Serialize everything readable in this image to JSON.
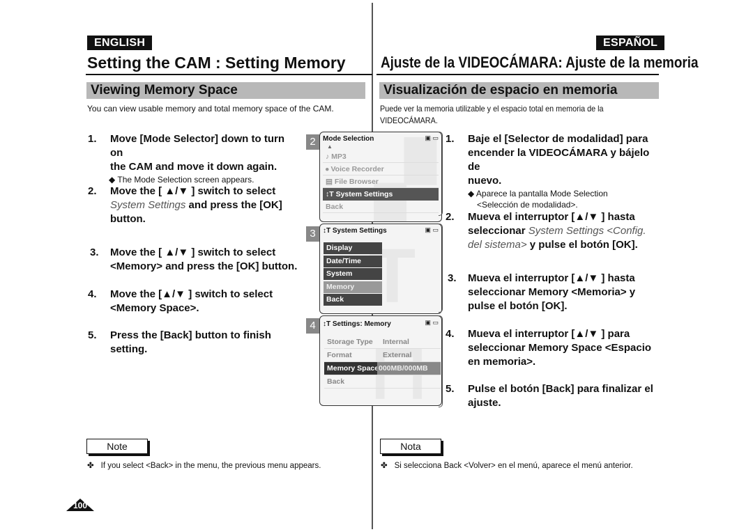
{
  "english": {
    "lang_label": "ENGLISH",
    "title": "Setting the CAM : Setting Memory",
    "section": "Viewing Memory Space",
    "intro": "You can view usable memory and total memory space of the CAM.",
    "steps": [
      {
        "num": "1.",
        "line1": "Move [Mode Selector] down to turn on",
        "line2": "the CAM and move it down again.",
        "sub": "The Mode Selection screen appears."
      },
      {
        "num": "2.",
        "line1": "Move the [ ▲/▼ ] switch to select",
        "line2_italic": "System Settings",
        "line2_rest": " and press the [OK]",
        "line3": "button."
      },
      {
        "num": "3.",
        "line1": "Move the [ ▲/▼ ] switch to select",
        "line2": "<Memory> and press the [OK] button."
      },
      {
        "num": "4.",
        "line1": "Move the [▲/▼ ] switch to select",
        "line2": "<Memory Space>."
      },
      {
        "num": "5.",
        "line1": "Press the [Back] button to finish",
        "line2": "setting."
      }
    ],
    "note_label": "Note",
    "note_text": "If you select <Back> in the menu, the previous menu appears."
  },
  "spanish": {
    "lang_label": "ESPAÑOL",
    "title": "Ajuste de la VIDEOCÁMARA: Ajuste de la memoria",
    "section": "Visualización de espacio en memoria",
    "intro_line1": "Puede ver la memoria utilizable y el espacio total en memoria de la",
    "intro_line2": "VIDEOCÁMARA.",
    "steps": [
      {
        "num": "1.",
        "line1": "Baje el [Selector de modalidad] para",
        "line2": "encender la VIDEOCÁMARA y bájelo de",
        "line3": "nuevo.",
        "sub1": "Aparece la pantalla Mode Selection",
        "sub2": "<Selección de modalidad>."
      },
      {
        "num": "2.",
        "line1": "Mueva el interruptor [▲/▼ ] hasta",
        "line2_a": "seleccionar ",
        "line2_italic": "System Settings <Config.",
        "line3_italic": "del sistema>",
        "line3_rest": " y pulse el botón [OK]."
      },
      {
        "num": "3.",
        "line1": "Mueva el interruptor [▲/▼ ] hasta",
        "line2": "seleccionar Memory <Memoria> y",
        "line3": "pulse el botón [OK]."
      },
      {
        "num": "4.",
        "line1": "Mueva el interruptor [▲/▼ ] para",
        "line2": "seleccionar Memory Space <Espacio",
        "line3": "en memoria>."
      },
      {
        "num": "5.",
        "line1": "Pulse el botón [Back] para finalizar el",
        "line2": "ajuste."
      }
    ],
    "note_label": "Nota",
    "note_text": "Si selecciona Back <Volver> en el menú, aparece el menú anterior."
  },
  "screens": [
    {
      "number": "2",
      "title": "Mode Selection",
      "items": [
        {
          "icon": "music-note-icon",
          "glyph": "♪",
          "label": "MP3"
        },
        {
          "icon": "microphone-icon",
          "glyph": "🎙",
          "label": "Voice Recorder"
        },
        {
          "icon": "file-icon",
          "glyph": "▤",
          "label": "File Browser"
        },
        {
          "icon": "settings-tools-icon",
          "glyph": "⫶T",
          "label": "System Settings",
          "selected": true
        },
        {
          "label": "Back"
        }
      ]
    },
    {
      "number": "3",
      "title": "System Settings",
      "items": [
        {
          "label": "Display"
        },
        {
          "label": "Date/Time"
        },
        {
          "label": "System"
        },
        {
          "label": "Memory",
          "highlighted": true
        },
        {
          "label": "Back"
        }
      ]
    },
    {
      "number": "4",
      "title": "Settings: Memory",
      "rows": [
        {
          "key": "Storage Type",
          "value": "Internal"
        },
        {
          "key": "Format",
          "value": "External"
        },
        {
          "key": "Memory Space",
          "value": "000MB/000MB",
          "selected": true
        },
        {
          "key": "Back",
          "value": ""
        }
      ]
    }
  ],
  "status_icons": {
    "memory": "▣",
    "battery": "▭"
  },
  "page_number": "100",
  "bullet_diamond": "◆",
  "bullet_note": "✤"
}
